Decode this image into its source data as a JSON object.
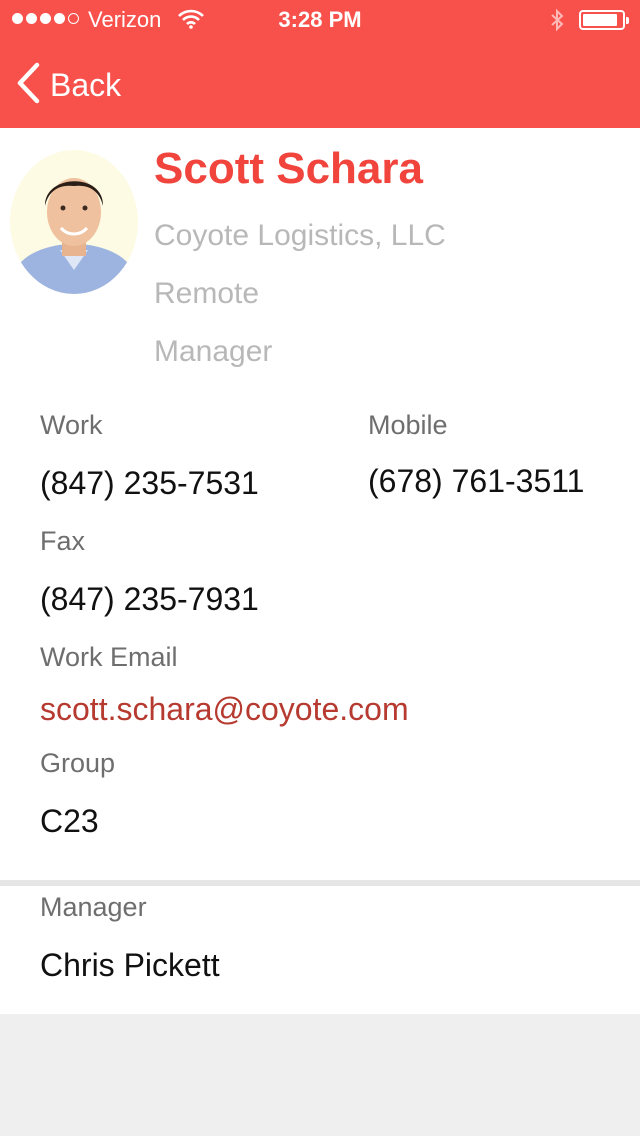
{
  "status_bar": {
    "carrier": "Verizon",
    "time": "3:28 PM",
    "signal_bars": 4,
    "signal_total": 5
  },
  "nav": {
    "back_label": "Back"
  },
  "contact": {
    "name": "Scott Schara",
    "company": "Coyote Logistics, LLC",
    "location": "Remote",
    "title": "Manager"
  },
  "fields": {
    "work_label": "Work",
    "work_value": "(847) 235-7531",
    "mobile_label": "Mobile",
    "mobile_value": "(678) 761-3511",
    "fax_label": "Fax",
    "fax_value": "(847) 235-7931",
    "email_label": "Work Email",
    "email_value": "scott.schara@coyote.com",
    "group_label": "Group",
    "group_value": "C23"
  },
  "manager": {
    "label": "Manager",
    "value": "Chris Pickett"
  },
  "colors": {
    "accent": "#f8514c",
    "name": "#f0443d",
    "email": "#b63a30"
  }
}
